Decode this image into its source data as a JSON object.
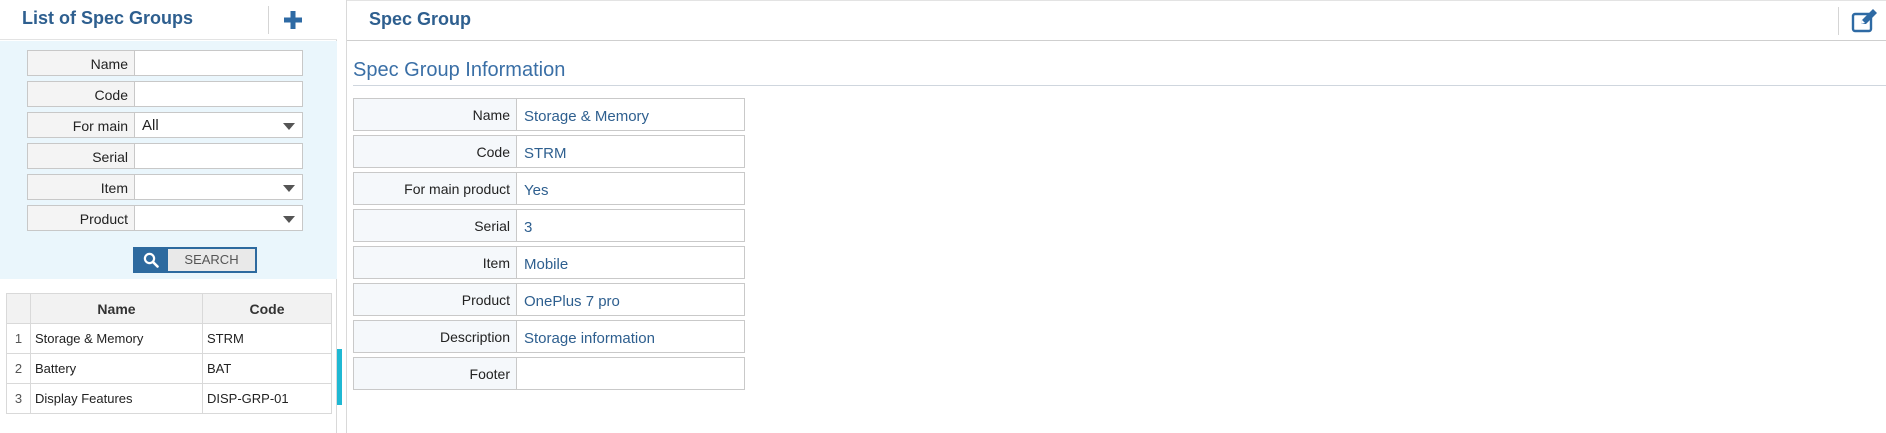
{
  "left_panel": {
    "title": "List of Spec Groups",
    "add_icon": "plus-icon",
    "filters": {
      "name_label": "Name",
      "name_value": "",
      "code_label": "Code",
      "code_value": "",
      "for_main_label": "For main",
      "for_main_value": "All",
      "serial_label": "Serial",
      "serial_value": "",
      "item_label": "Item",
      "item_value": "",
      "product_label": "Product",
      "product_value": ""
    },
    "search_button": {
      "icon": "search-icon",
      "label": "SEARCH"
    },
    "table": {
      "headers": {
        "name": "Name",
        "code": "Code"
      },
      "rows": [
        {
          "index": "1",
          "name": "Storage & Memory",
          "code": "STRM"
        },
        {
          "index": "2",
          "name": "Battery",
          "code": "BAT"
        },
        {
          "index": "3",
          "name": "Display Features",
          "code": "DISP-GRP-01"
        }
      ]
    }
  },
  "right_panel": {
    "title": "Spec Group",
    "edit_icon": "edit-icon",
    "section_title": "Spec Group Information",
    "fields": [
      {
        "label": "Name",
        "value": "Storage & Memory"
      },
      {
        "label": "Code",
        "value": "STRM"
      },
      {
        "label": "For main product",
        "value": "Yes"
      },
      {
        "label": "Serial",
        "value": "3"
      },
      {
        "label": "Item",
        "value": "Mobile"
      },
      {
        "label": "Product",
        "value": "OnePlus 7 pro"
      },
      {
        "label": "Description",
        "value": "Storage information"
      },
      {
        "label": "Footer",
        "value": ""
      }
    ]
  },
  "colors": {
    "title_blue": "#2e5f8f",
    "accent_blue": "#2d6a9f",
    "filter_bg": "#eaf6fc",
    "scroll_indicator": "#1fb8d3"
  }
}
